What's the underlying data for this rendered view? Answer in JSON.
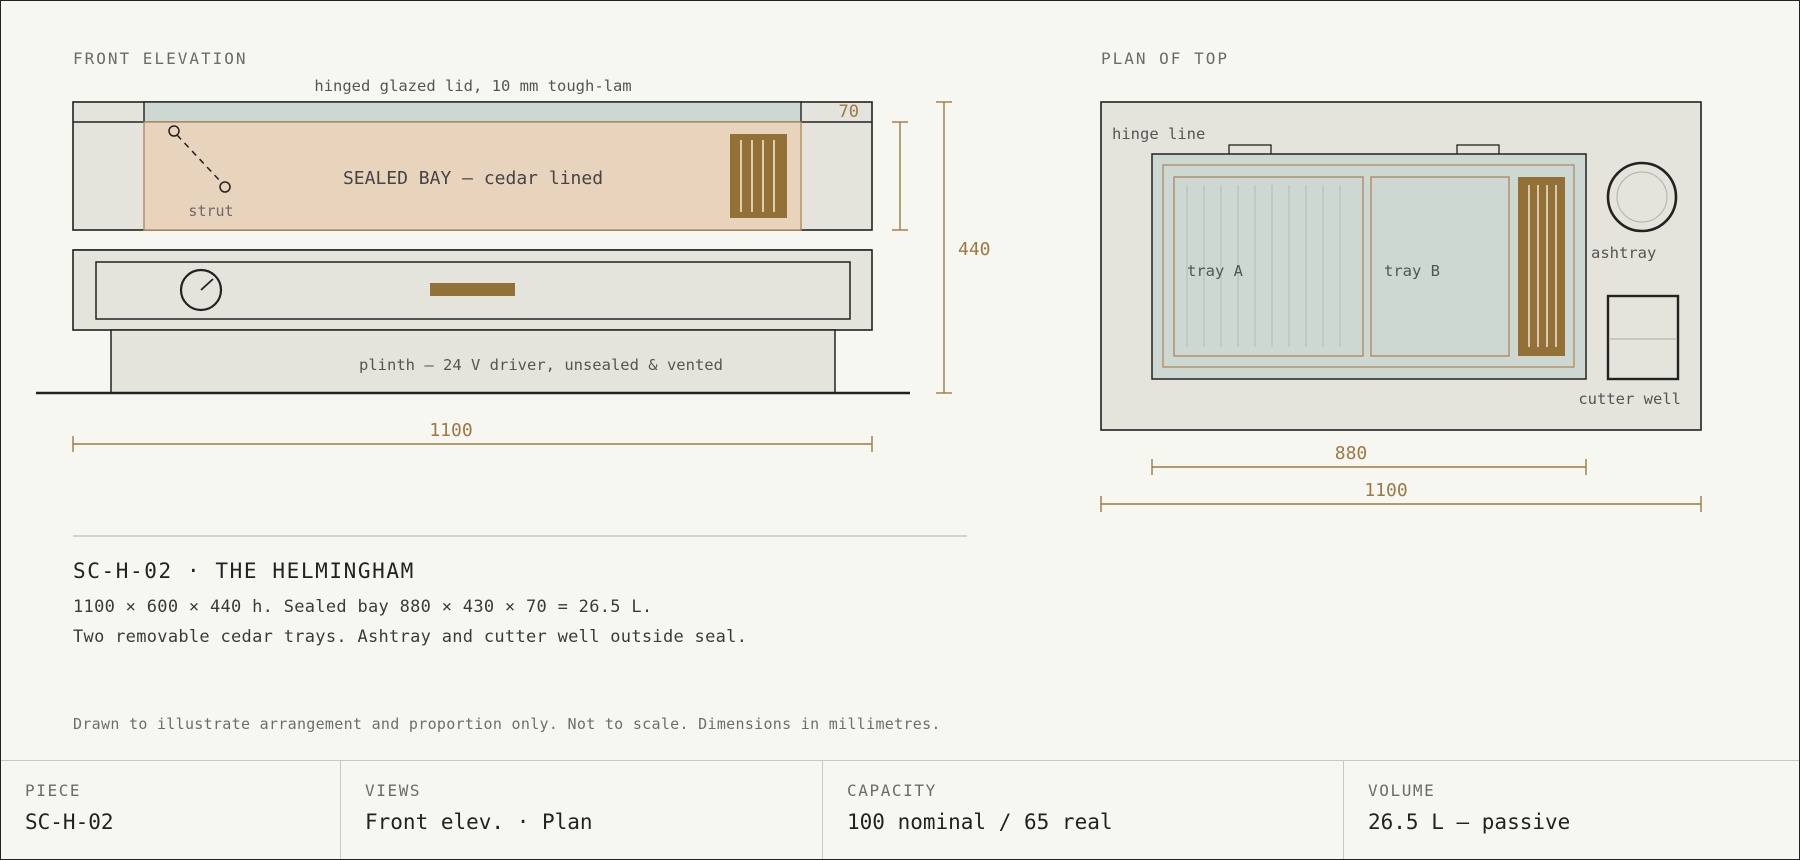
{
  "front": {
    "heading": "FRONT ELEVATION",
    "lid_label": "hinged glazed lid, 10 mm tough-lam",
    "bay_label": "SEALED BAY — cedar lined",
    "strut_label": "strut",
    "plinth_label": "plinth — 24 V driver, unsealed & vented",
    "dim_width": "1100",
    "dim_height": "440",
    "dim_depth": "70"
  },
  "plan": {
    "heading": "PLAN OF TOP",
    "hinge_label": "hinge line",
    "tray_a": "tray A",
    "tray_b": "tray B",
    "ashtray_label": "ashtray",
    "cutter_label": "cutter well",
    "dim_inner": "880",
    "dim_outer": "1100"
  },
  "title": {
    "name": "SC-H-02 · THE HELMINGHAM",
    "line1": "1100 × 600 × 440 h. Sealed bay 880 × 430 × 70 = 26.5 L.",
    "line2": "Two removable cedar trays. Ashtray and cutter well outside seal."
  },
  "note": "Drawn to illustrate arrangement and proportion only. Not to scale. Dimensions in millimetres.",
  "footer": [
    {
      "key": "PIECE",
      "value": "SC-H-02"
    },
    {
      "key": "VIEWS",
      "value": "Front elev. · Plan"
    },
    {
      "key": "CAPACITY",
      "value": "100 nominal / 65 real"
    },
    {
      "key": "VOLUME",
      "value": "26.5 L — passive"
    }
  ],
  "colors": {
    "dimension": "#9b7a43",
    "cedar_fill": "#e8d3bd",
    "glass": "#cdd8d2",
    "humidifier": "#937036",
    "panel": "#e4e4dd"
  }
}
